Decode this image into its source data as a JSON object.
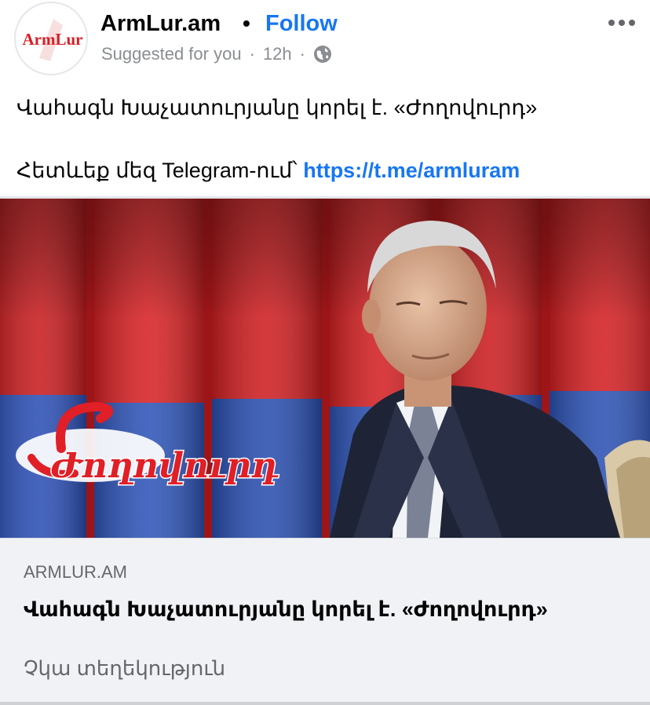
{
  "post": {
    "page_name": "ArmLur.am",
    "separator": "•",
    "follow_label": "Follow",
    "suggested_label": "Suggested for you",
    "dot": "·",
    "time": "12h",
    "privacy_icon": "globe-icon",
    "more_icon": "more-horizontal-icon",
    "avatar_logo_text": "ArmLur",
    "text_line1": "Վահագն Խաչատուրյանը կորել է. «Ժողովուրդ»",
    "text_line2_prefix": "Հետևեք մեզ  Telegram-ում՝ ",
    "text_link": "https://t.me/armluram"
  },
  "image": {
    "logo_text": "Ժողովուրդ",
    "colors": {
      "flag_red": "#d01c1f",
      "flag_blue": "#2a4fb0",
      "flag_orange": "#f2a800",
      "logo_red": "#e01f26"
    }
  },
  "link_preview": {
    "domain": "ARMLUR.AM",
    "title": "Վահագն Խաչատուրյանը կորել է. «Ժողովուրդ»",
    "description": "Չկա տեղեկություն"
  },
  "colors": {
    "accent": "#1877f2",
    "text": "#050505",
    "muted": "#65676b",
    "card_bg": "#f0f2f5"
  }
}
